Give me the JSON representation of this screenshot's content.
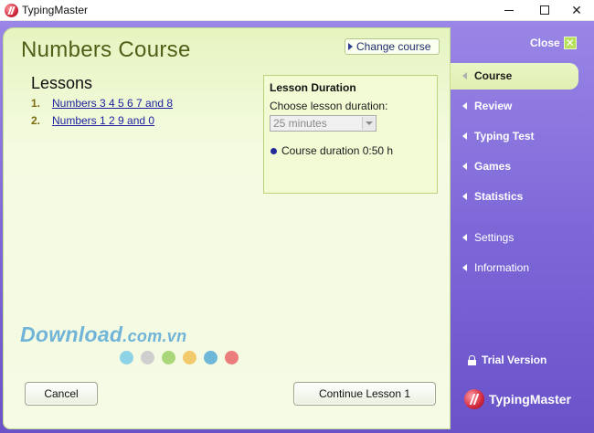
{
  "window": {
    "title": "TypingMaster",
    "min_label": "",
    "max_label": "",
    "close_label": "✕"
  },
  "main": {
    "course_title": "Numbers Course",
    "change_course_label": "Change course",
    "lessons_heading": "Lessons",
    "lessons": [
      {
        "number": "1.",
        "label": "Numbers 3 4 5 6 7 and 8"
      },
      {
        "number": "2.",
        "label": "Numbers 1 2 9 and 0"
      }
    ],
    "duration": {
      "title": "Lesson Duration",
      "label": "Choose lesson duration:",
      "selected": "25 minutes",
      "info": "Course duration 0:50 h"
    },
    "cancel_label": "Cancel",
    "continue_label": "Continue Lesson 1"
  },
  "watermark": {
    "main": "Download",
    "suffix": ".com.vn",
    "dot_colors": [
      "#8fd4e6",
      "#cfcfcf",
      "#a9d77a",
      "#f2c96b",
      "#6fb7d9",
      "#ec7d7d"
    ]
  },
  "sidebar": {
    "close_label": "Close",
    "close_icon": "✕",
    "items": [
      {
        "label": "Course"
      },
      {
        "label": "Review"
      },
      {
        "label": "Typing Test"
      },
      {
        "label": "Games"
      },
      {
        "label": "Statistics"
      },
      {
        "label": "Settings"
      },
      {
        "label": "Information"
      }
    ],
    "trial_label": "Trial Version",
    "brand_label": "TypingMaster"
  },
  "colors": {
    "frame_purple": "#7e68d8",
    "panel_green": "#f4fbe1",
    "link_blue": "#1b1fa0",
    "title_olive": "#4e6018"
  }
}
